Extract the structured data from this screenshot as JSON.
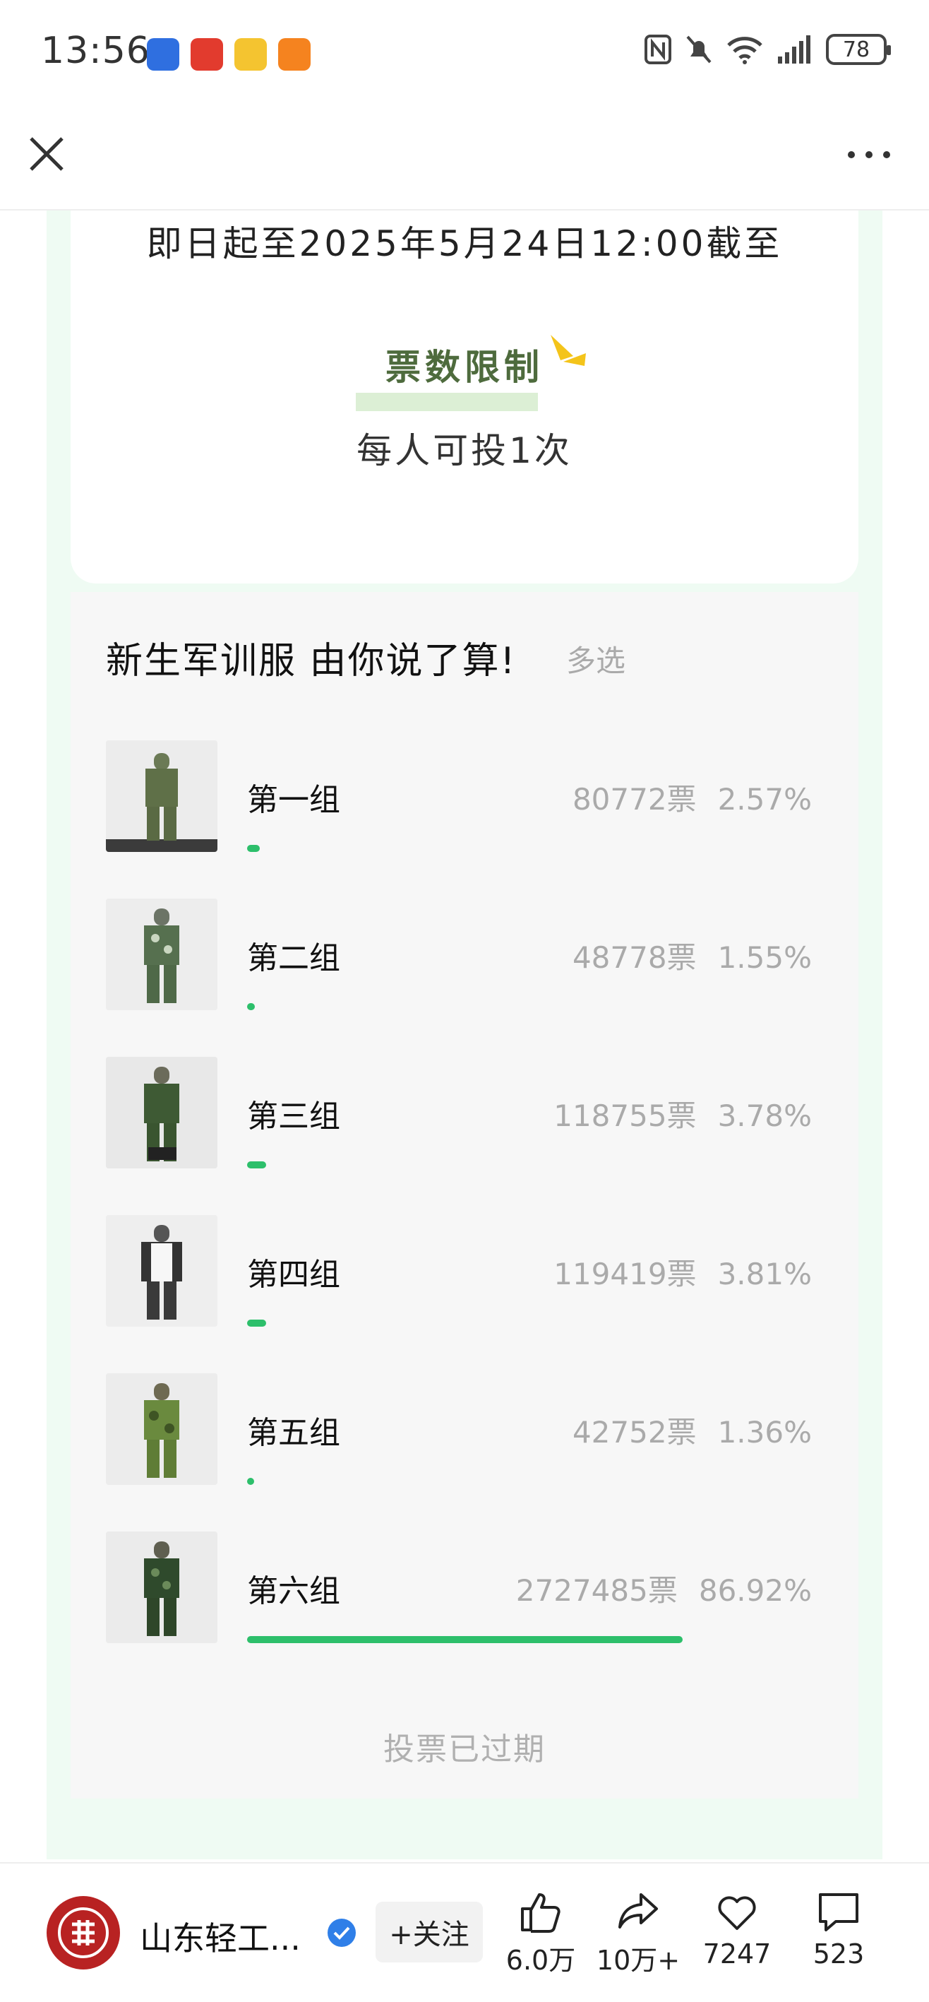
{
  "status_bar": {
    "time": "13:56",
    "battery": "78"
  },
  "poll_info": {
    "deadline": "即日起至2025年5月24日12:00截至",
    "limit_title": "票数限制",
    "limit_text": "每人可投1次"
  },
  "poll": {
    "title": "新生军训服 由你说了算!",
    "mode": "多选",
    "options": [
      {
        "label": "第一组",
        "votes": "80772票",
        "percent": "2.57%",
        "share": 2.57
      },
      {
        "label": "第二组",
        "votes": "48778票",
        "percent": "1.55%",
        "share": 1.55
      },
      {
        "label": "第三组",
        "votes": "118755票",
        "percent": "3.78%",
        "share": 3.78
      },
      {
        "label": "第四组",
        "votes": "119419票",
        "percent": "3.81%",
        "share": 3.81
      },
      {
        "label": "第五组",
        "votes": "42752票",
        "percent": "1.36%",
        "share": 1.36
      },
      {
        "label": "第六组",
        "votes": "2727485票",
        "percent": "86.92%",
        "share": 86.92
      }
    ],
    "status": "投票已过期"
  },
  "bottom_bar": {
    "account_name": "山东轻工...",
    "follow_label": "+关注",
    "likes": "6.0万",
    "shares": "10万+",
    "favorites": "7247",
    "comments": "523"
  },
  "colors": {
    "accent_green": "#2dbf6b",
    "limit_title": "#4e6b3d",
    "page_bg_green": "#effbf3"
  }
}
